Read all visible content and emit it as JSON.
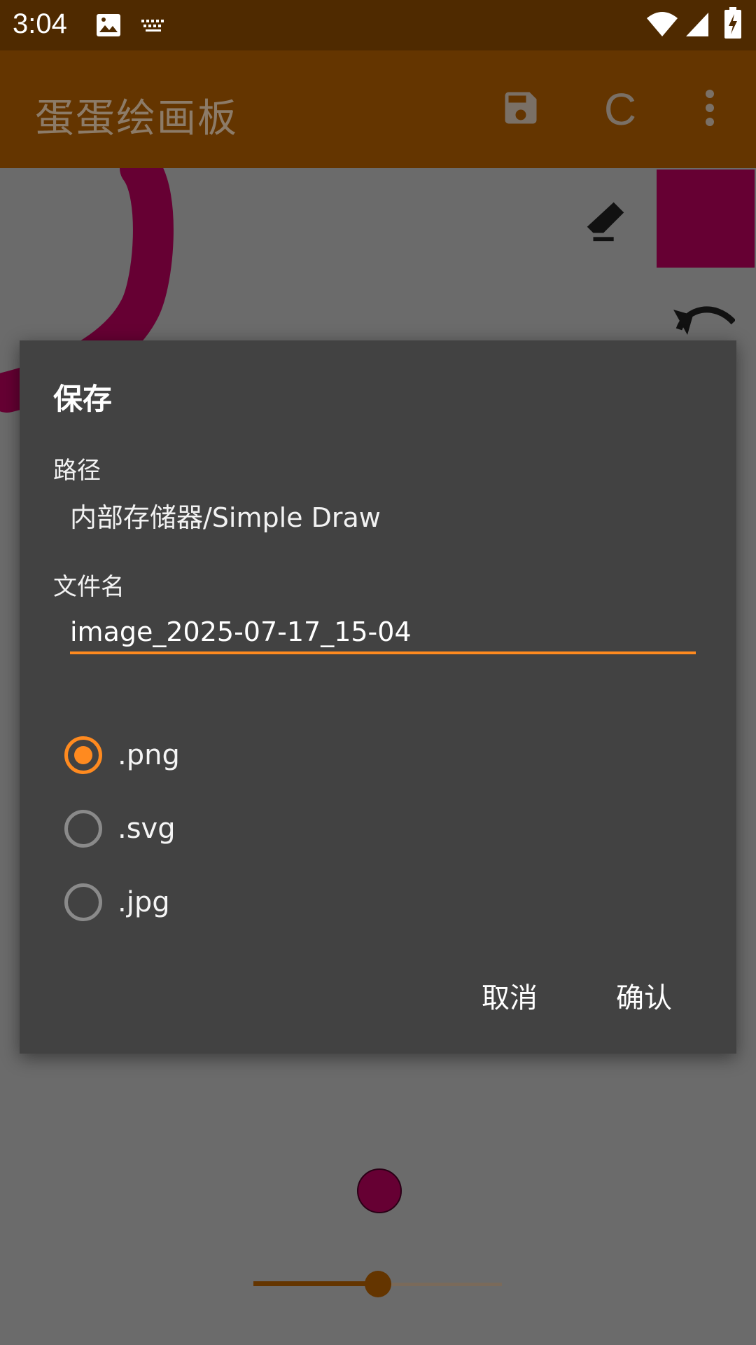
{
  "status_bar": {
    "time": "3:04",
    "icons": [
      "image-icon",
      "keyboard-icon",
      "wifi-icon",
      "signal-icon",
      "battery-charging-icon"
    ]
  },
  "toolbar": {
    "title": "蛋蛋绘画板",
    "c_label": "C",
    "icons": [
      "save-icon",
      "more-vert-icon"
    ]
  },
  "canvas": {
    "brush_color": "#660033",
    "tools": [
      "eraser-icon",
      "undo-icon"
    ]
  },
  "dialog": {
    "title": "保存",
    "path_label": "路径",
    "path_value": "内部存储器/Simple Draw",
    "filename_label": "文件名",
    "filename_value": "image_2025-07-17_15-04",
    "formats": [
      {
        "label": ".png",
        "checked": true
      },
      {
        "label": ".svg",
        "checked": false
      },
      {
        "label": ".jpg",
        "checked": false
      }
    ],
    "cancel_label": "取消",
    "confirm_label": "确认",
    "accent_color": "#ff8a1f"
  },
  "brush_size_slider": {
    "value_fraction": 0.5
  }
}
